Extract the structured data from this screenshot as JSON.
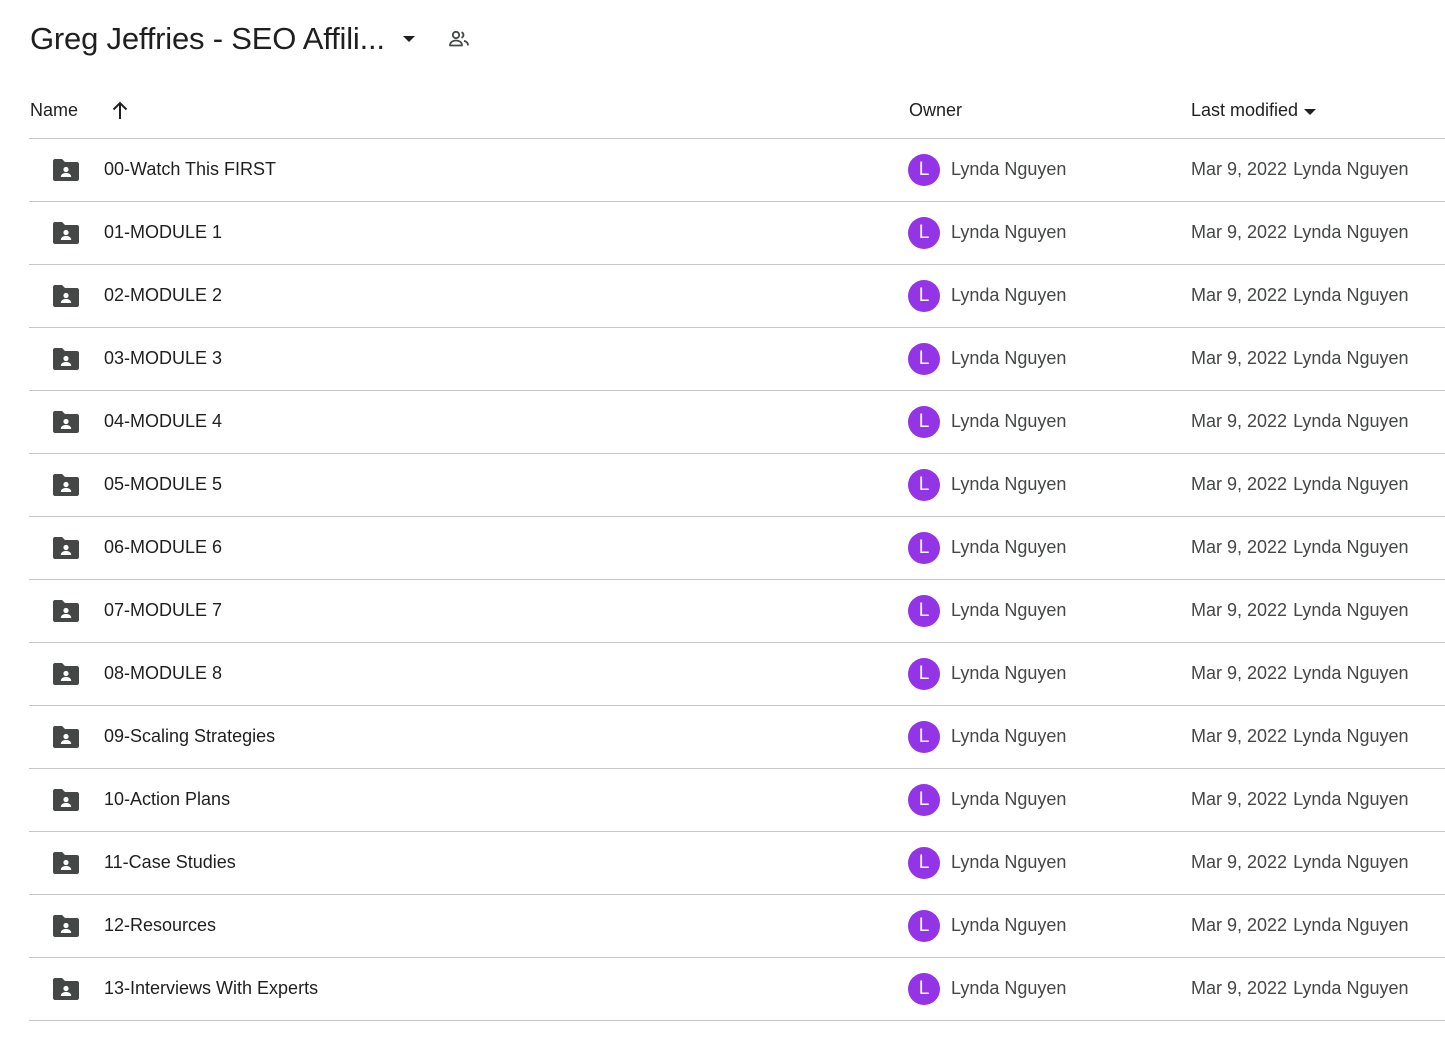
{
  "header": {
    "title": "Greg Jeffries - SEO Affili...",
    "dropdown_icon": "arrow-drop-down-icon",
    "shared_icon": "people-icon"
  },
  "columns": {
    "name": "Name",
    "owner": "Owner",
    "last_modified": "Last modified",
    "sort_icon": "arrow-up-icon",
    "modified_sort_icon": "arrow-drop-down-icon"
  },
  "colors": {
    "avatar": "#9334e6",
    "folder": "#444746",
    "divider": "#c7c7c7"
  },
  "rows": [
    {
      "name": "00-Watch This FIRST",
      "owner_initial": "L",
      "owner": "Lynda Nguyen",
      "modified_date": "Mar 9, 2022",
      "modified_by": "Lynda Nguyen"
    },
    {
      "name": "01-MODULE 1",
      "owner_initial": "L",
      "owner": "Lynda Nguyen",
      "modified_date": "Mar 9, 2022",
      "modified_by": "Lynda Nguyen"
    },
    {
      "name": "02-MODULE 2",
      "owner_initial": "L",
      "owner": "Lynda Nguyen",
      "modified_date": "Mar 9, 2022",
      "modified_by": "Lynda Nguyen"
    },
    {
      "name": "03-MODULE 3",
      "owner_initial": "L",
      "owner": "Lynda Nguyen",
      "modified_date": "Mar 9, 2022",
      "modified_by": "Lynda Nguyen"
    },
    {
      "name": "04-MODULE 4",
      "owner_initial": "L",
      "owner": "Lynda Nguyen",
      "modified_date": "Mar 9, 2022",
      "modified_by": "Lynda Nguyen"
    },
    {
      "name": "05-MODULE 5",
      "owner_initial": "L",
      "owner": "Lynda Nguyen",
      "modified_date": "Mar 9, 2022",
      "modified_by": "Lynda Nguyen"
    },
    {
      "name": "06-MODULE 6",
      "owner_initial": "L",
      "owner": "Lynda Nguyen",
      "modified_date": "Mar 9, 2022",
      "modified_by": "Lynda Nguyen"
    },
    {
      "name": "07-MODULE 7",
      "owner_initial": "L",
      "owner": "Lynda Nguyen",
      "modified_date": "Mar 9, 2022",
      "modified_by": "Lynda Nguyen"
    },
    {
      "name": "08-MODULE 8",
      "owner_initial": "L",
      "owner": "Lynda Nguyen",
      "modified_date": "Mar 9, 2022",
      "modified_by": "Lynda Nguyen"
    },
    {
      "name": "09-Scaling Strategies",
      "owner_initial": "L",
      "owner": "Lynda Nguyen",
      "modified_date": "Mar 9, 2022",
      "modified_by": "Lynda Nguyen"
    },
    {
      "name": "10-Action Plans",
      "owner_initial": "L",
      "owner": "Lynda Nguyen",
      "modified_date": "Mar 9, 2022",
      "modified_by": "Lynda Nguyen"
    },
    {
      "name": "11-Case Studies",
      "owner_initial": "L",
      "owner": "Lynda Nguyen",
      "modified_date": "Mar 9, 2022",
      "modified_by": "Lynda Nguyen"
    },
    {
      "name": "12-Resources",
      "owner_initial": "L",
      "owner": "Lynda Nguyen",
      "modified_date": "Mar 9, 2022",
      "modified_by": "Lynda Nguyen"
    },
    {
      "name": "13-Interviews With Experts",
      "owner_initial": "L",
      "owner": "Lynda Nguyen",
      "modified_date": "Mar 9, 2022",
      "modified_by": "Lynda Nguyen"
    }
  ]
}
